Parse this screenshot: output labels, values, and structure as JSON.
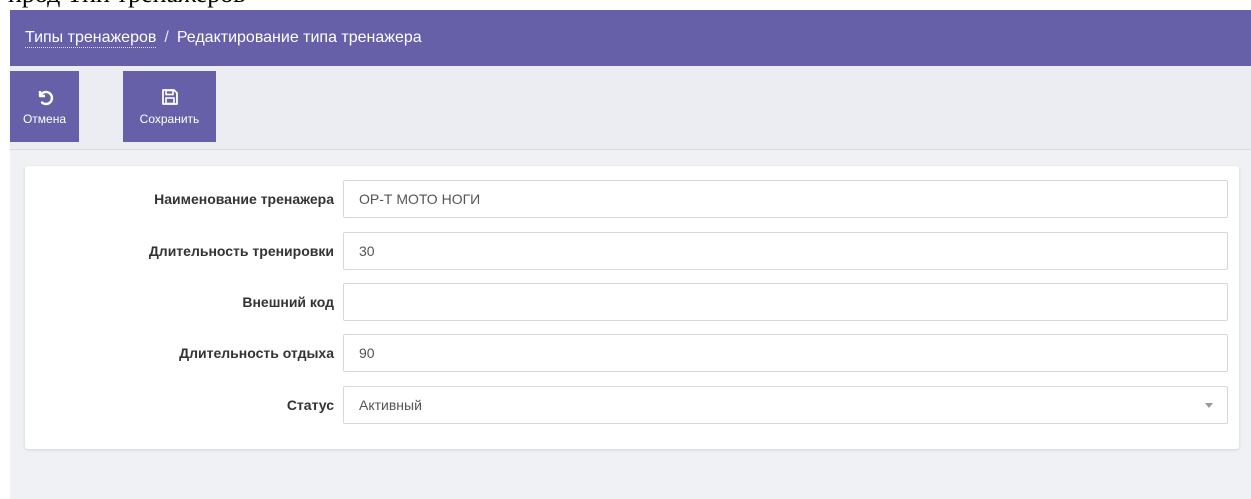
{
  "top_strip_text": "прод Тип тренажеров",
  "breadcrumb": {
    "parent": "Типы тренажеров",
    "separator": "/",
    "current": "Редактирование типа тренажера"
  },
  "toolbar": {
    "cancel_label": "Отмена",
    "cancel_icon": "undo-icon",
    "save_label": "Сохранить",
    "save_icon": "floppy-disk-icon"
  },
  "form": {
    "fields": [
      {
        "label": "Наименование тренажера",
        "value": "ОР-Т МОТО НОГИ"
      },
      {
        "label": "Длительность тренировки",
        "value": "30"
      },
      {
        "label": "Внешний код",
        "value": ""
      },
      {
        "label": "Длительность отдыха",
        "value": "90"
      },
      {
        "label": "Статус",
        "value": "Активный"
      }
    ]
  },
  "colors": {
    "header_bg": "#6560a8",
    "toolbar_bg": "#ecedf2",
    "content_bg": "#f0f1f5"
  }
}
